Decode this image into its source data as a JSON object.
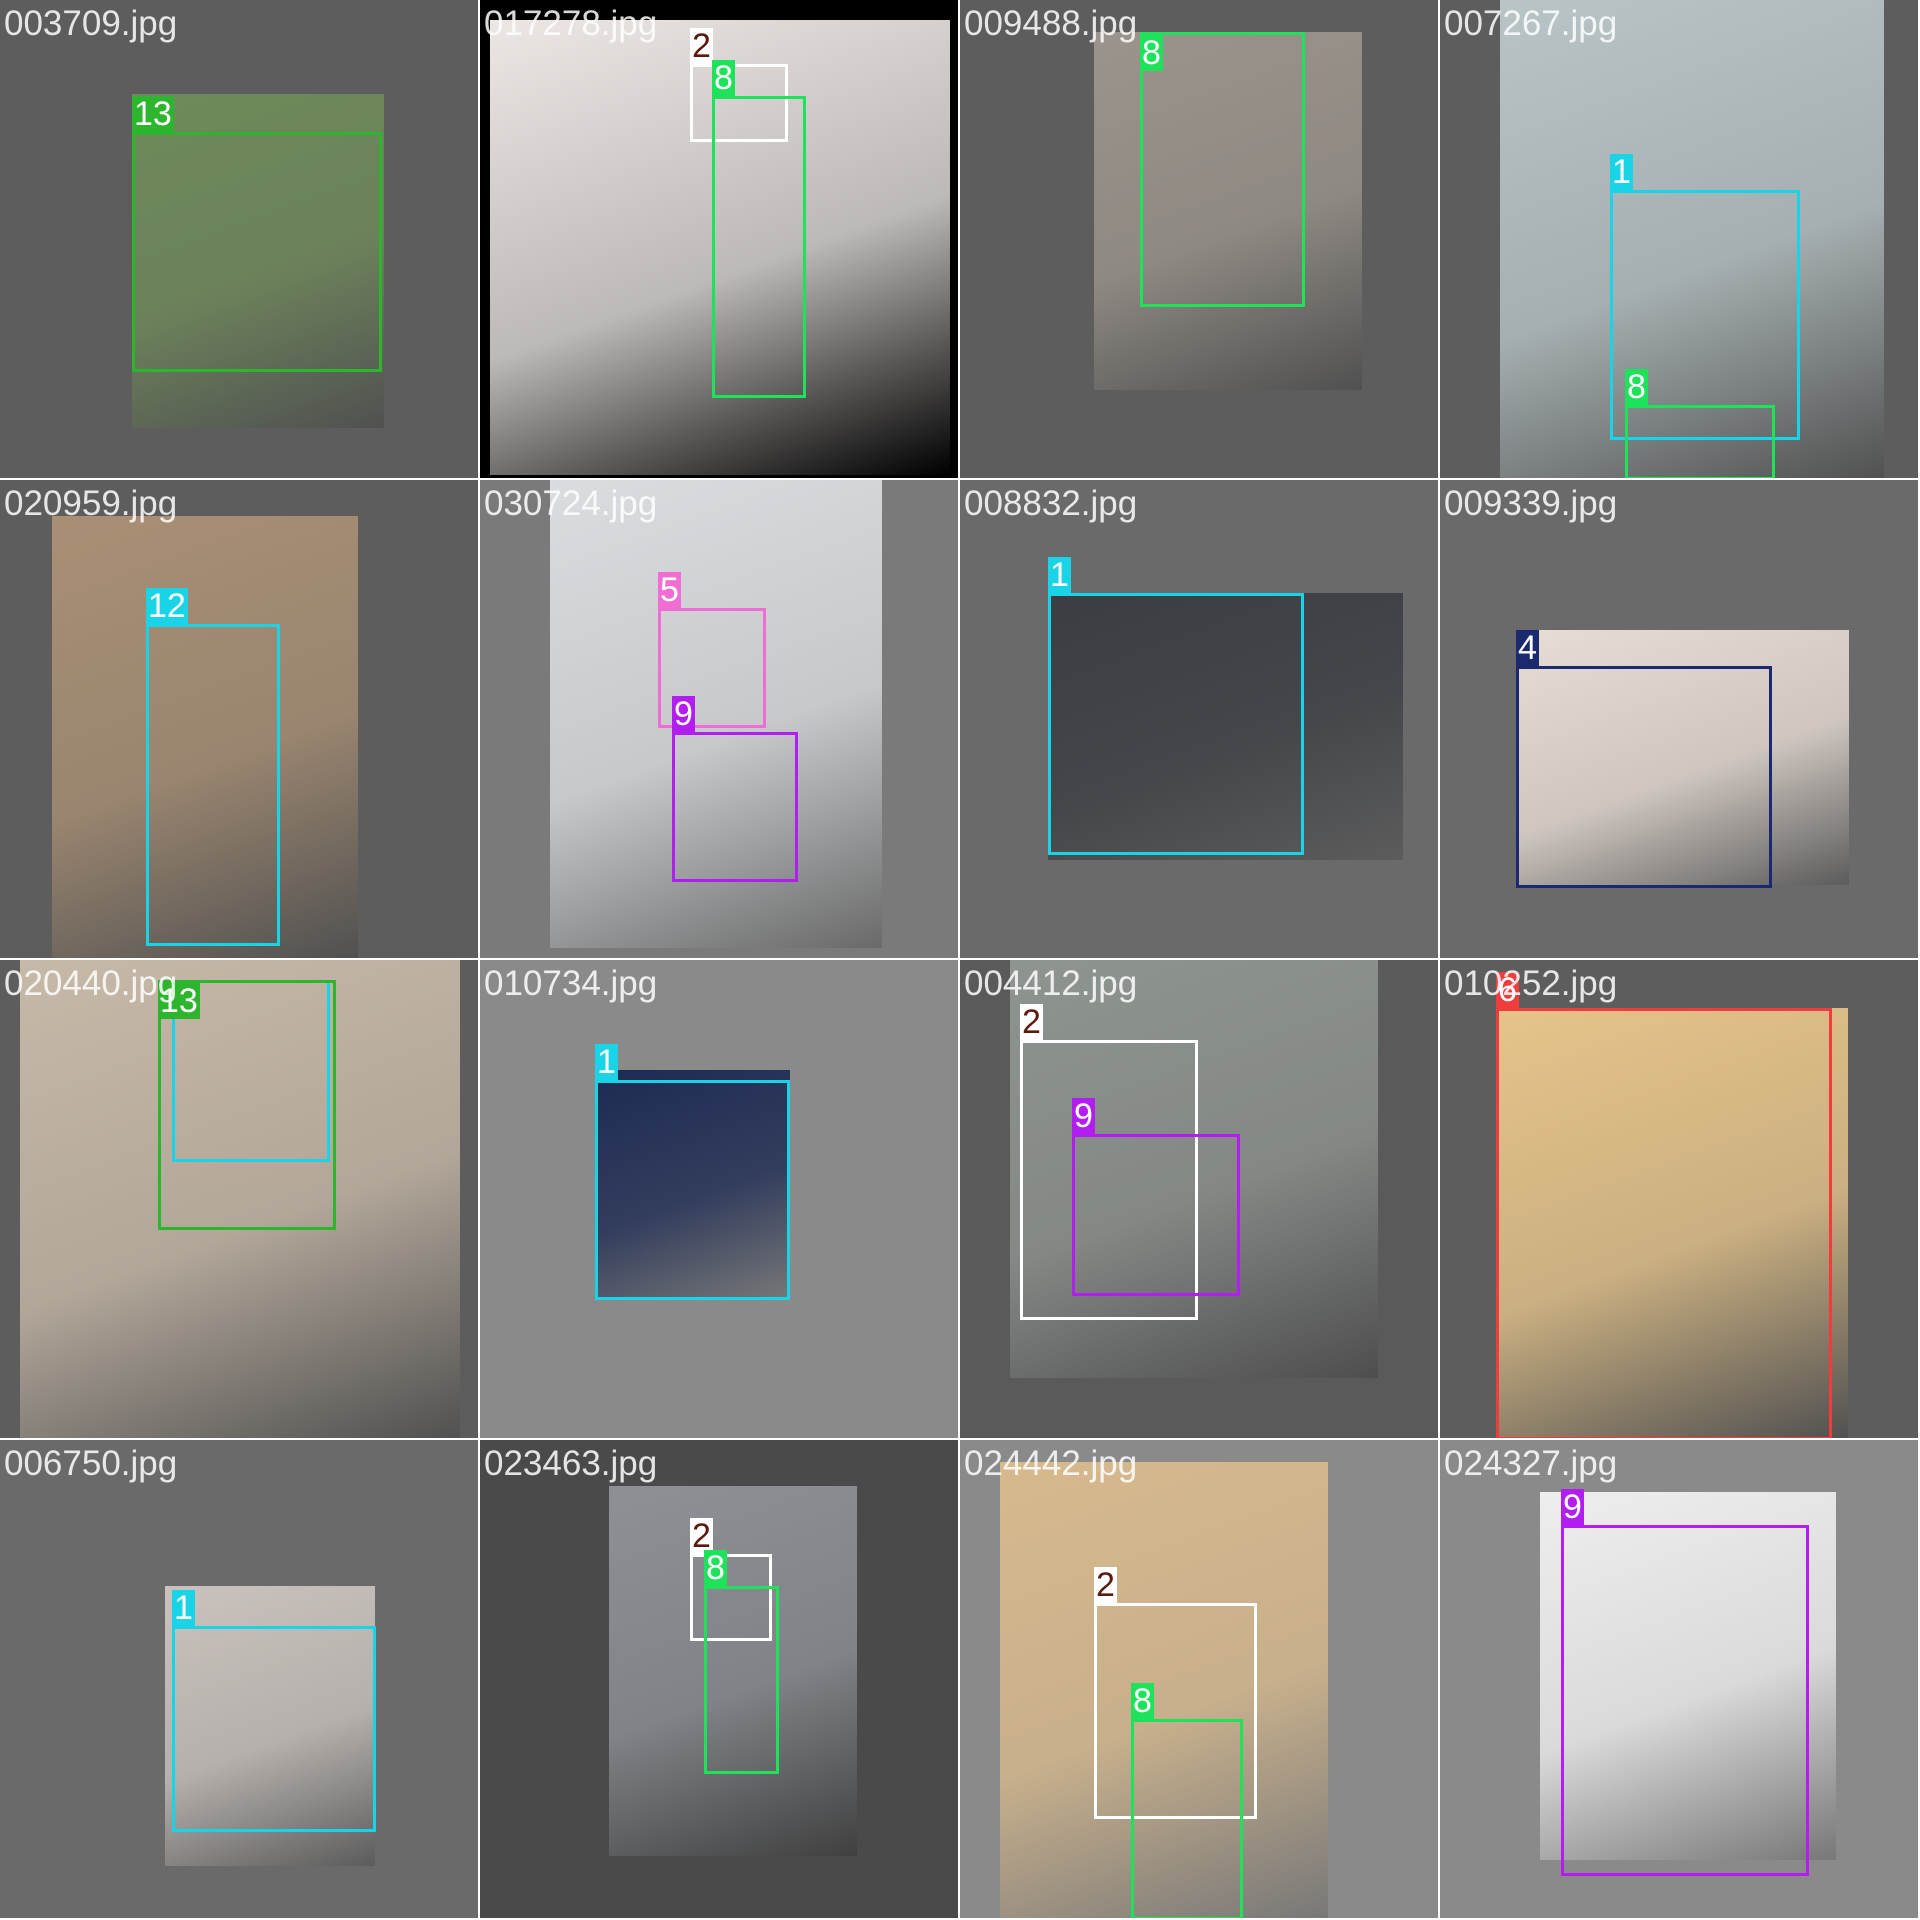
{
  "class_colors": {
    "1": "#18d4e6",
    "2": "#ffffff",
    "4": "#1b2a6e",
    "5": "#f06ed4",
    "6": "#f03c3c",
    "8": "#1ee35a",
    "9": "#b21ef0",
    "12": "#18d4e6",
    "13": "#2db52d"
  },
  "label_text_colors": {
    "2": "#5a1a10"
  },
  "tiles": [
    {
      "filename": "003709.jpg",
      "bg": "#5d5d5d",
      "photo_color": "#6f8a5a",
      "boxes": [
        {
          "label": "13"
        }
      ]
    },
    {
      "filename": "017278.jpg",
      "bg": "#000000",
      "photo_color": "#ece7e4",
      "boxes": [
        {
          "label": "2"
        },
        {
          "label": "8"
        }
      ]
    },
    {
      "filename": "009488.jpg",
      "bg": "#5d5d5d",
      "photo_color": "#9b948c",
      "boxes": [
        {
          "label": "8"
        }
      ]
    },
    {
      "filename": "007267.jpg",
      "bg": "#5d5d5d",
      "photo_color": "#b8c4c6",
      "boxes": [
        {
          "label": "1"
        },
        {
          "label": "8"
        }
      ]
    },
    {
      "filename": "020959.jpg",
      "bg": "#5d5d5d",
      "photo_color": "#a98f74",
      "boxes": [
        {
          "label": "12"
        }
      ]
    },
    {
      "filename": "030724.jpg",
      "bg": "#7a7a7a",
      "photo_color": "#d9dde0",
      "boxes": [
        {
          "label": "5"
        },
        {
          "label": "9"
        }
      ]
    },
    {
      "filename": "008832.jpg",
      "bg": "#6a6a6a",
      "photo_color": "#3a3d42",
      "boxes": [
        {
          "label": "1"
        }
      ]
    },
    {
      "filename": "009339.jpg",
      "bg": "#6a6a6a",
      "photo_color": "#e8ddd5",
      "boxes": [
        {
          "label": "4"
        }
      ]
    },
    {
      "filename": "020440.jpg",
      "bg": "#5d5d5d",
      "photo_color": "#c7b9a8",
      "boxes": [
        {
          "label": "1"
        },
        {
          "label": "13"
        }
      ]
    },
    {
      "filename": "010734.jpg",
      "bg": "#8a8a8a",
      "photo_color": "#1d2a52",
      "boxes": [
        {
          "label": "1"
        }
      ]
    },
    {
      "filename": "004412.jpg",
      "bg": "#5a5a5a",
      "photo_color": "#8e9490",
      "boxes": [
        {
          "label": "2"
        },
        {
          "label": "9"
        }
      ]
    },
    {
      "filename": "010252.jpg",
      "bg": "#5d5d5d",
      "photo_color": "#e6c48a",
      "boxes": [
        {
          "label": "6"
        }
      ]
    },
    {
      "filename": "006750.jpg",
      "bg": "#6a6a6a",
      "photo_color": "#c9c2bd",
      "boxes": [
        {
          "label": "1"
        }
      ]
    },
    {
      "filename": "023463.jpg",
      "bg": "#4a4a4a",
      "photo_color": "#8d9196",
      "boxes": [
        {
          "label": "2"
        },
        {
          "label": "8"
        }
      ]
    },
    {
      "filename": "024442.jpg",
      "bg": "#8a8a8a",
      "photo_color": "#d7b98d",
      "boxes": [
        {
          "label": "2"
        },
        {
          "label": "8"
        }
      ]
    },
    {
      "filename": "024327.jpg",
      "bg": "#8a8a8a",
      "photo_color": "#eeeeee",
      "boxes": [
        {
          "label": "9"
        }
      ]
    }
  ]
}
